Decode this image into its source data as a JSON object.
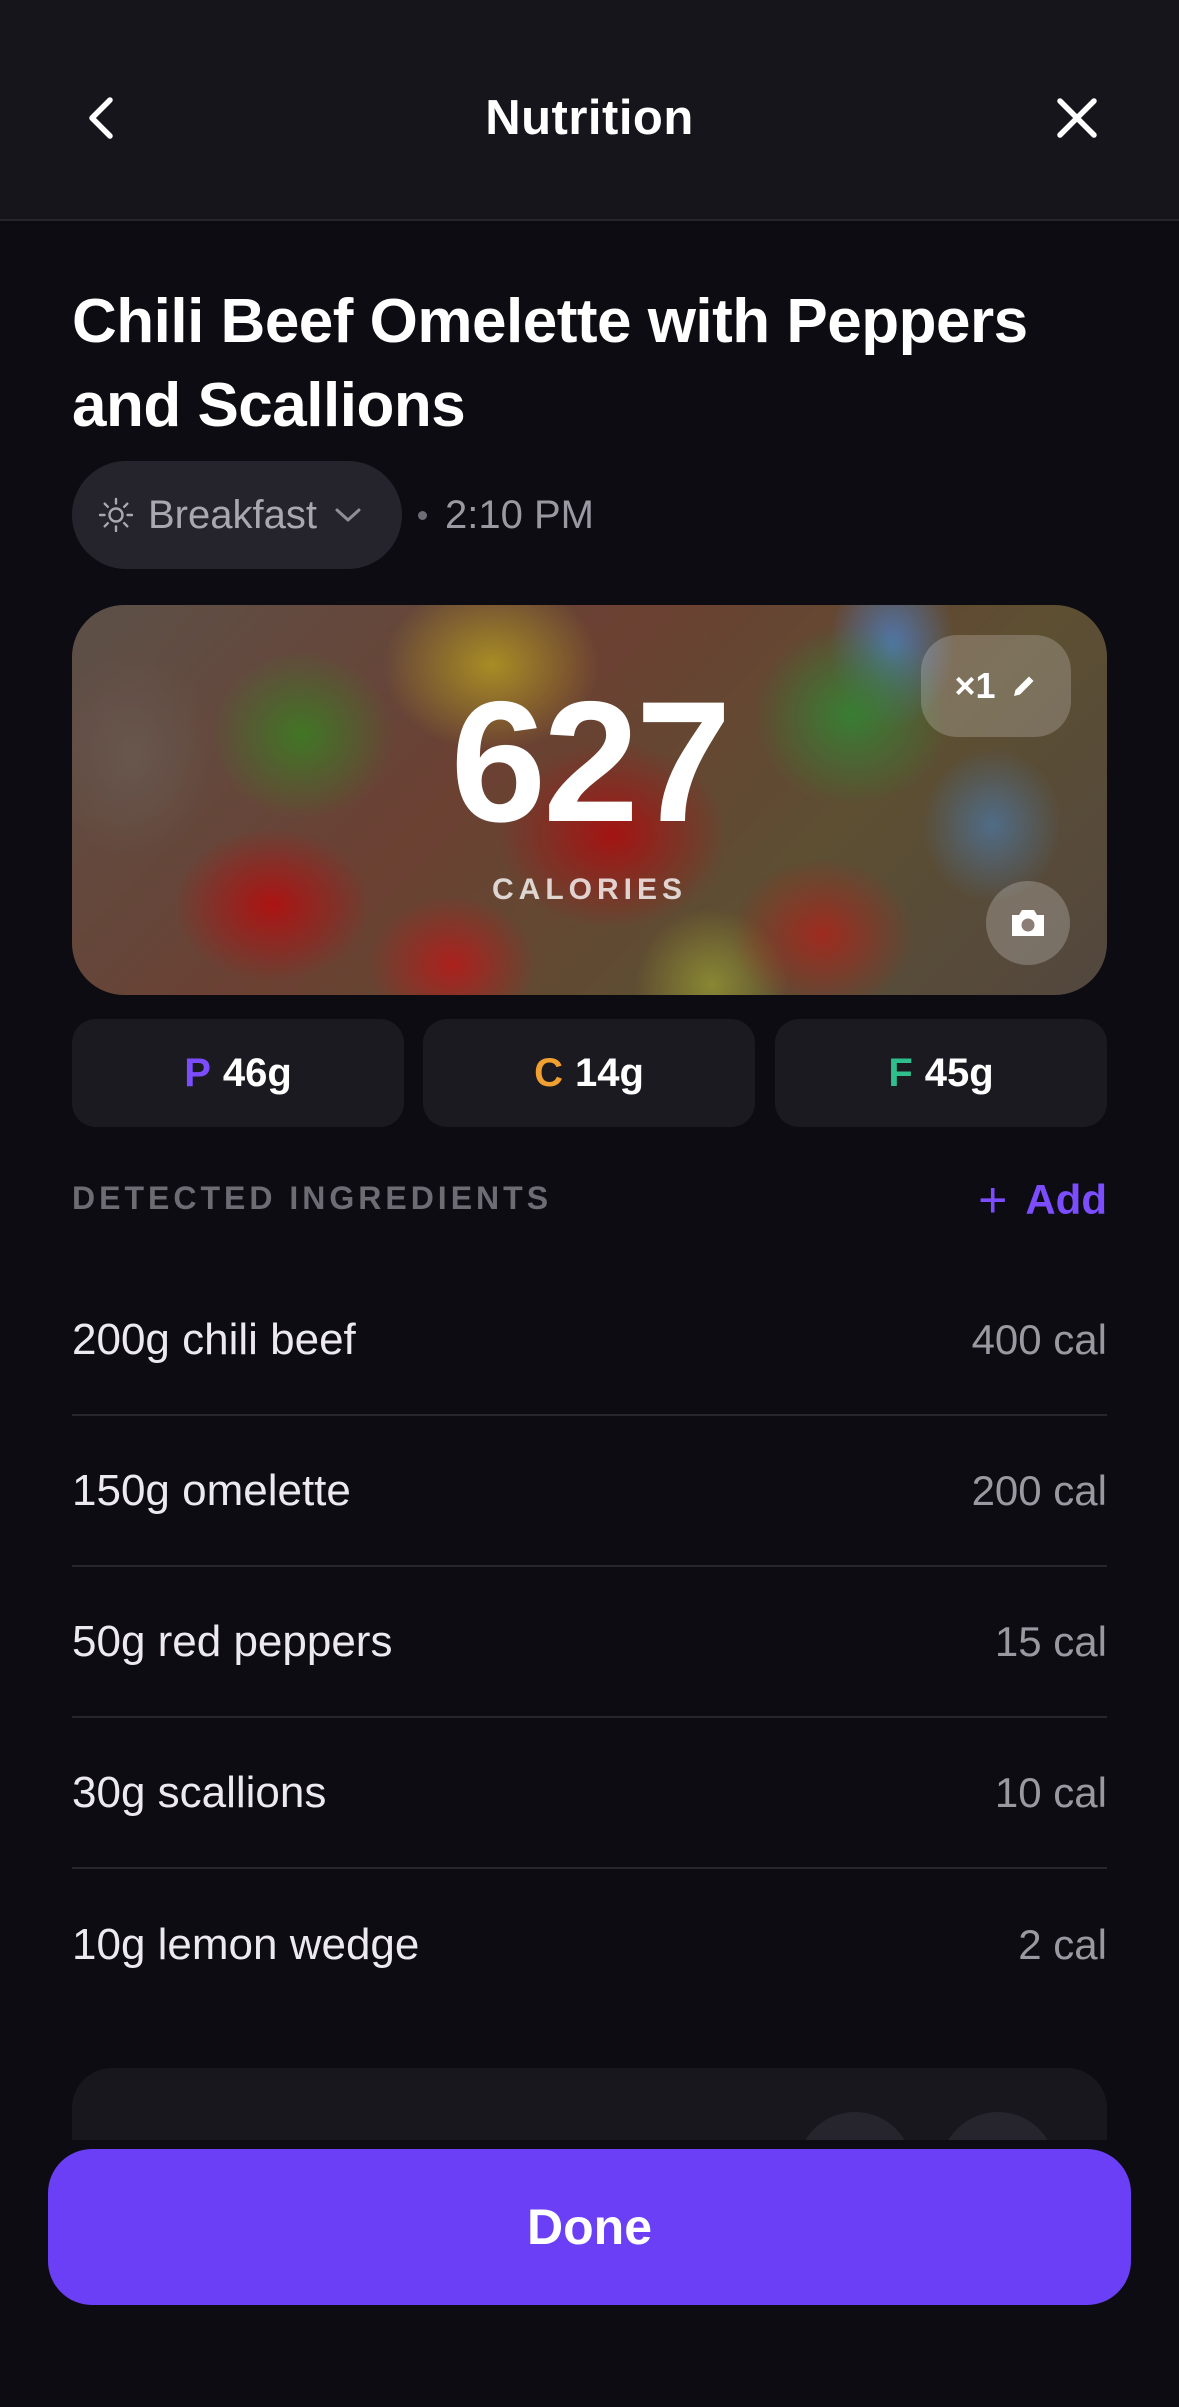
{
  "header": {
    "title": "Nutrition",
    "back_icon": "chevron-left-icon",
    "close_icon": "close-icon"
  },
  "meal": {
    "title": "Chili Beef Omelette with Peppers and Scallions",
    "meal_type": "Breakfast",
    "meal_type_icon": "sun-icon",
    "time": "2:10 PM"
  },
  "hero": {
    "calories": "627",
    "calories_label": "CALORIES",
    "servings": "×1",
    "servings_icon": "pencil-icon",
    "camera_icon": "camera-icon"
  },
  "macros": [
    {
      "letter": "P",
      "value": "46g",
      "color": "#7c4dff"
    },
    {
      "letter": "C",
      "value": "14g",
      "color": "#f0a030"
    },
    {
      "letter": "F",
      "value": "45g",
      "color": "#2fbf8c"
    }
  ],
  "ingredients_section": {
    "title": "DETECTED INGREDIENTS",
    "add_label": "Add"
  },
  "ingredients": [
    {
      "name": "200g chili beef",
      "calories": "400 cal"
    },
    {
      "name": "150g omelette",
      "calories": "200 cal"
    },
    {
      "name": "50g red peppers",
      "calories": "15 cal"
    },
    {
      "name": "30g scallions",
      "calories": "10 cal"
    },
    {
      "name": "10g lemon wedge",
      "calories": "2 cal"
    }
  ],
  "footer": {
    "done_label": "Done"
  },
  "colors": {
    "accent": "#6b3ff5",
    "background": "#0d0c12"
  }
}
